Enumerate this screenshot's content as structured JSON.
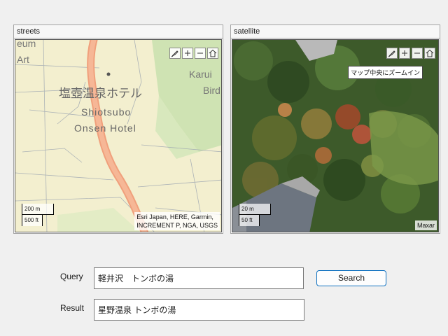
{
  "panels": {
    "streets": {
      "title": "streets",
      "labels": {
        "hotel_jp": "塩壺温泉ホテル",
        "hotel_en_1": "Shiotsubo",
        "hotel_en_2": "Onsen Hotel",
        "top_left_1": "eum",
        "top_left_2": "Art",
        "right_1": "Karui",
        "right_2": "Bird"
      },
      "scale": {
        "metric": "200 m",
        "imperial": "500 ft"
      },
      "attribution_line1": "Esri Japan, HERE, Garmin,",
      "attribution_line2": "INCREMENT P, NGA, USGS"
    },
    "satellite": {
      "title": "satellite",
      "tooltip": "マップ中央にズームイン",
      "scale": {
        "metric": "20 m",
        "imperial": "50 ft"
      },
      "attribution": "Maxar"
    }
  },
  "toolbar_icons": [
    "brush-icon",
    "zoom-in-icon",
    "zoom-out-icon",
    "home-icon"
  ],
  "form": {
    "query_label": "Query",
    "query_value": "軽井沢　トンボの湯",
    "result_label": "Result",
    "result_value": "星野温泉 トンボの湯",
    "search_label": "Search"
  },
  "colors": {
    "street_base": "#f3efcf",
    "street_road": "#f0a07c",
    "park": "#cfe3b3",
    "accent": "#0e70c0"
  }
}
